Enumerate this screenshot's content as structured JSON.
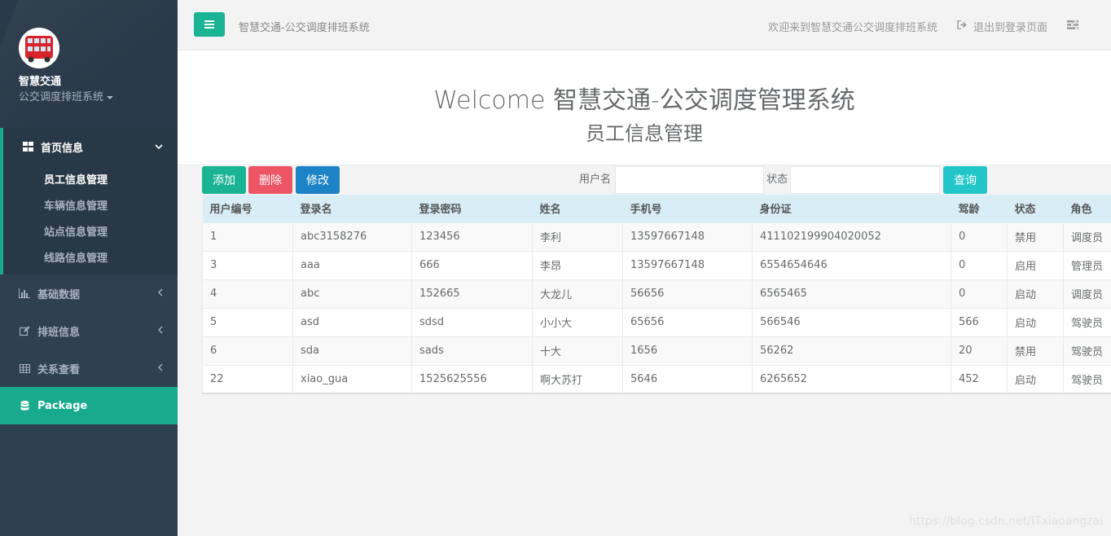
{
  "sidebar": {
    "brand_title": "智慧交通",
    "brand_sub": "公交调度排班系统",
    "groups": [
      {
        "label": "首页信息",
        "icon": "th-large-icon",
        "expanded": true,
        "items": [
          "员工信息管理",
          "车辆信息管理",
          "站点信息管理",
          "线路信息管理"
        ]
      },
      {
        "label": "基础数据",
        "icon": "bar-chart-icon"
      },
      {
        "label": "排班信息",
        "icon": "edit-icon"
      },
      {
        "label": "关系查看",
        "icon": "table-icon"
      },
      {
        "label": "Package",
        "icon": "database-icon"
      }
    ]
  },
  "topbar": {
    "title": "智慧交通-公交调度排班系统",
    "welcome": "欢迎来到智慧交通公交调度排班系统",
    "logout": "退出到登录页面"
  },
  "hero": {
    "title": "Welcome 智慧交通-公交调度管理系统",
    "subtitle": "员工信息管理"
  },
  "toolbar": {
    "add": "添加",
    "delete": "删除",
    "edit": "修改",
    "user_label": "用户名",
    "status_label": "状态",
    "query": "查询",
    "user_value": "",
    "status_value": ""
  },
  "table": {
    "headers": [
      "用户编号",
      "登录名",
      "登录密码",
      "姓名",
      "手机号",
      "身份证",
      "驾龄",
      "状态",
      "角色"
    ],
    "rows": [
      [
        "1",
        "abc3158276",
        "123456",
        "李利",
        "13597667148",
        "411102199904020052",
        "0",
        "禁用",
        "调度员"
      ],
      [
        "3",
        "aaa",
        "666",
        "李昂",
        "13597667148",
        "6554654646",
        "0",
        "启用",
        "管理员"
      ],
      [
        "4",
        "abc",
        "152665",
        "大龙儿",
        "56656",
        "6565465",
        "0",
        "启动",
        "调度员"
      ],
      [
        "5",
        "asd",
        "sdsd",
        "小小大",
        "65656",
        "566546",
        "566",
        "启动",
        "驾驶员"
      ],
      [
        "6",
        "sda",
        "sads",
        "十大",
        "1656",
        "56262",
        "20",
        "禁用",
        "驾驶员"
      ],
      [
        "22",
        "xiao_gua",
        "1525625556",
        "啊大苏打",
        "5646",
        "6265652",
        "452",
        "启动",
        "驾驶员"
      ]
    ]
  },
  "watermark": "https://blog.csdn.net/ITxiaoangzai",
  "colors": {
    "sidebar_bg": "#2f4050",
    "accent_green": "#1ab394",
    "danger_red": "#ed5565",
    "primary_blue": "#1c84c6",
    "info_cyan": "#23c6c8",
    "table_head_bg": "#d9edf7"
  }
}
